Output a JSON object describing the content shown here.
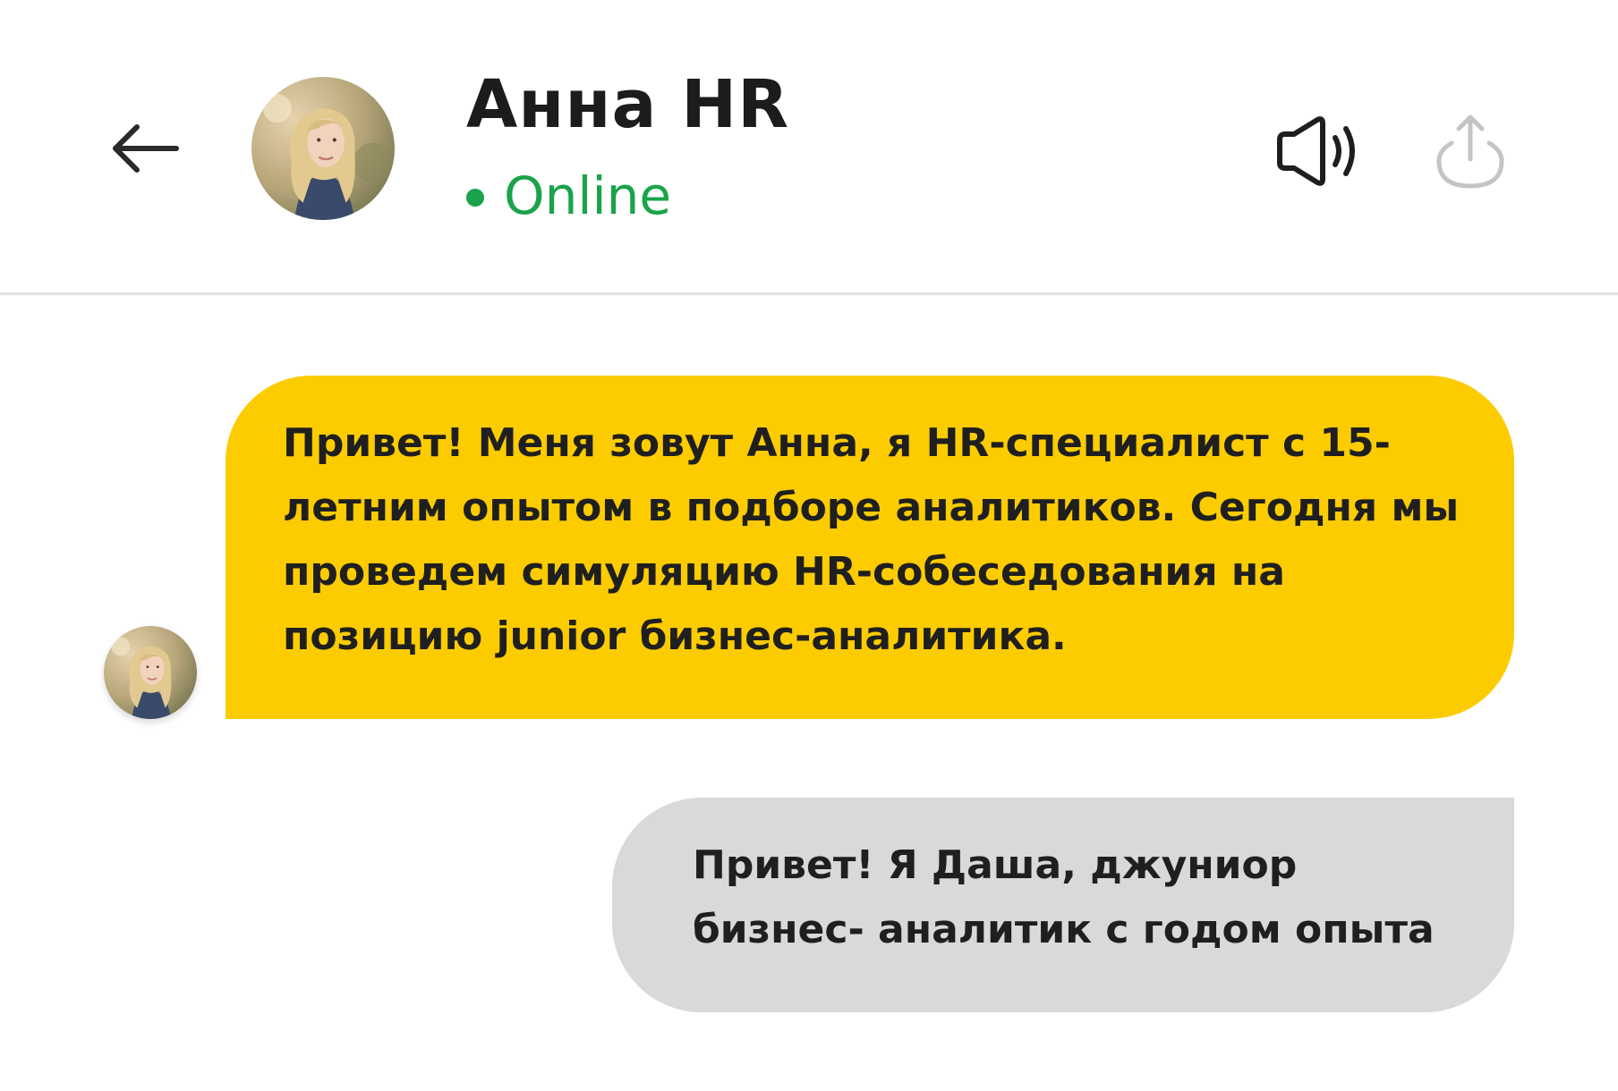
{
  "header": {
    "contact_name": "Анна HR",
    "status": "Online",
    "back_icon": "arrow-left-icon",
    "sound_icon": "speaker-icon",
    "share_icon": "share-upload-icon"
  },
  "messages": [
    {
      "sender": "Анна HR",
      "text": "Привет! Меня зовут Анна, я HR-специалист с 15-летним опытом в подборе аналитиков. Сегодня мы проведем симуляцию HR-собеседования на позицию junior бизнес-аналитика."
    },
    {
      "sender": "me",
      "text": "Привет! Я Даша, джуниор бизнес- аналитик с годом опыта"
    }
  ],
  "colors": {
    "incoming_bubble": "#fccc00",
    "outgoing_bubble": "#d9d9d9",
    "online": "#1aa34a",
    "divider": "#e2e2e2"
  }
}
